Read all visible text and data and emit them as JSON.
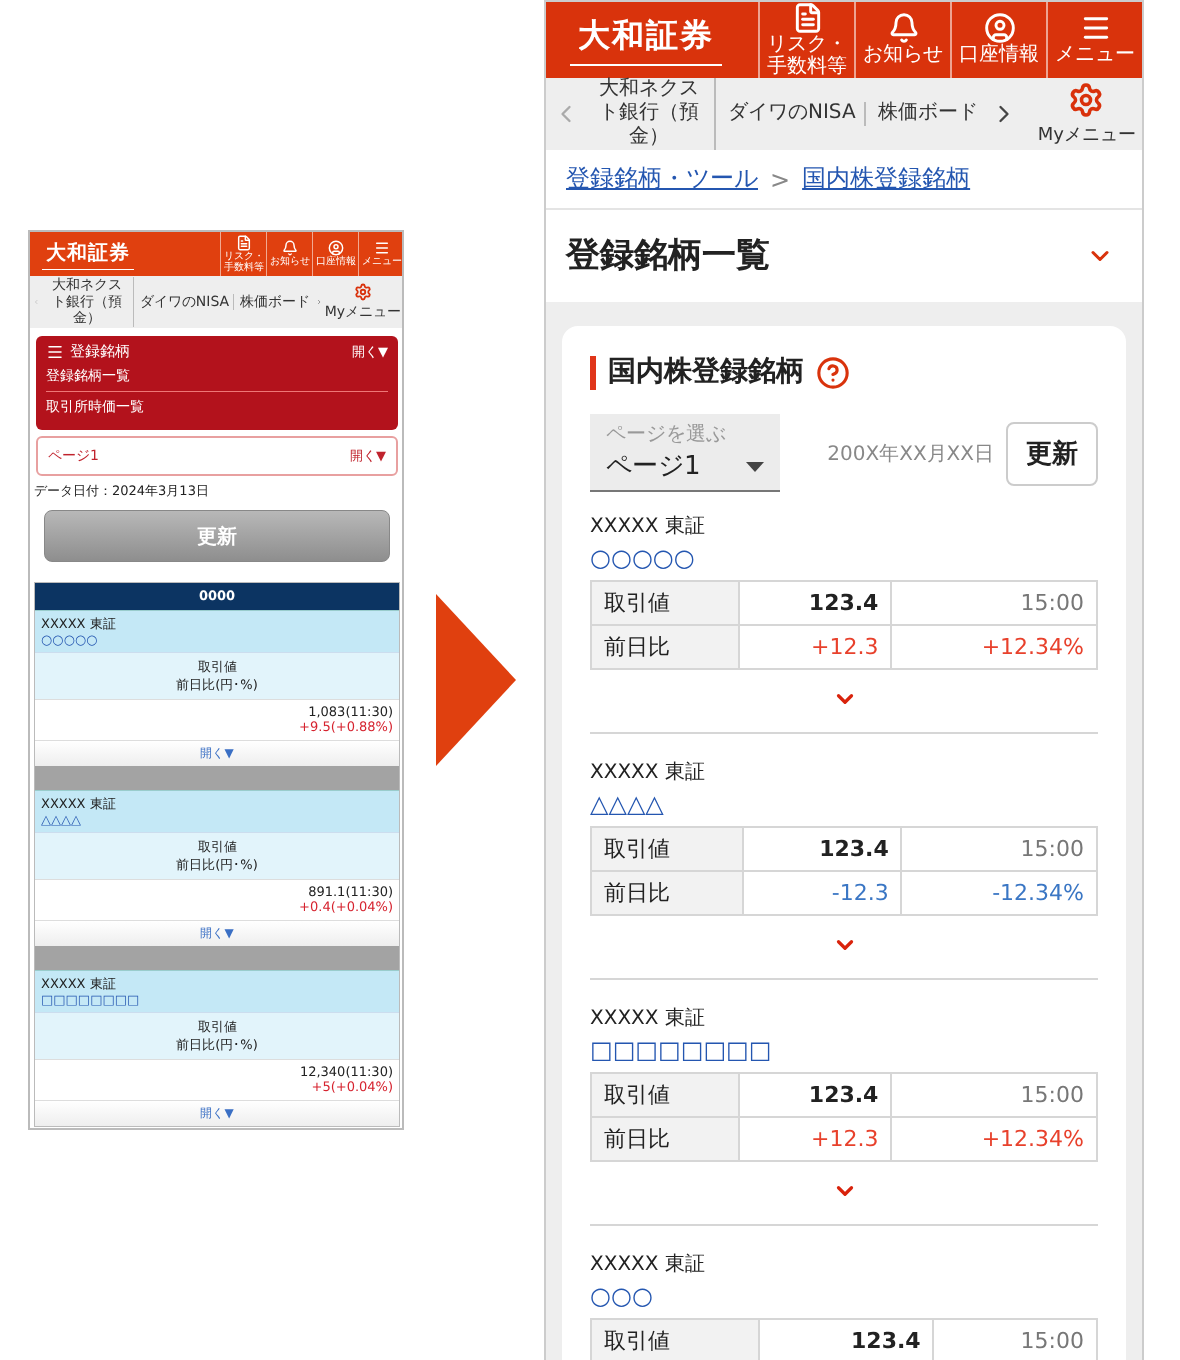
{
  "before": {
    "header": {
      "logo": "大和証券",
      "buttons": [
        {
          "kind": "document",
          "label": "リスク・手数料等"
        },
        {
          "kind": "bell",
          "label": "お知らせ"
        },
        {
          "kind": "user",
          "label": "口座情報"
        },
        {
          "kind": "menu",
          "label": "メニュー"
        }
      ]
    },
    "nav": {
      "items": [
        "大和ネクスト銀行（預金）",
        "ダイワのNISA",
        "株価ボード"
      ],
      "my_menu": "Myメニュー"
    },
    "menu": {
      "title": "登録銘柄",
      "toggle": "開く▼",
      "items": [
        "登録銘柄一覧",
        "取引所時価一覧"
      ]
    },
    "page_select": {
      "value": "ページ1",
      "toggle": "開く▼"
    },
    "data_date": "データ日付：2024年3月13日",
    "update_button": "更新",
    "table": {
      "header": "0000",
      "rows": [
        {
          "name": "XXXXX 東証",
          "symbol": "○○○○○",
          "label_1": "取引値",
          "label_2": "前日比(円･%)",
          "price": "1,083(11:30)",
          "change": "+9.5(+0.88%)",
          "color": "#d6232f",
          "toggle": "開く▼"
        },
        {
          "name": "XXXXX 東証",
          "symbol": "△△△△",
          "label_1": "取引値",
          "label_2": "前日比(円･%)",
          "price": "891.1(11:30)",
          "change": "+0.4(+0.04%)",
          "color": "#d6232f",
          "toggle": "開く▼"
        },
        {
          "name": "XXXXX 東証",
          "symbol": "□□□□□□□□",
          "label_1": "取引値",
          "label_2": "前日比(円･%)",
          "price": "12,340(11:30)",
          "change": "+5(+0.04%)",
          "color": "#d6232f",
          "toggle": "開く▼"
        }
      ]
    }
  },
  "after": {
    "header": {
      "logo": "大和証券",
      "buttons": [
        {
          "kind": "document",
          "label": "リスク・手数料等"
        },
        {
          "kind": "bell",
          "label": "お知らせ"
        },
        {
          "kind": "user",
          "label": "口座情報"
        },
        {
          "kind": "menu",
          "label": "メニュー"
        }
      ]
    },
    "nav": {
      "items": [
        "大和ネクスト銀行（預金）",
        "ダイワのNISA",
        "株価ボード"
      ],
      "my_menu": "Myメニュー"
    },
    "breadcrumb": [
      "登録銘柄・ツール",
      "国内株登録銘柄"
    ],
    "breadcrumb_separator": ">",
    "title": "登録銘柄一覧",
    "card": {
      "title": "国内株登録銘柄",
      "select": {
        "placeholder": "ページを選ぶ",
        "value": "ページ1"
      },
      "date": "200X年XX月XX日",
      "update_button": "更新",
      "items": [
        {
          "name": "XXXXX",
          "market": "東証",
          "symbol": "○○○○○",
          "price_label": "取引値",
          "price": "123.4",
          "time": "15:00",
          "change_label": "前日比",
          "change": "+12.3",
          "change_pct": "+12.34%",
          "color": "#e8412c"
        },
        {
          "name": "XXXXX",
          "market": "東証",
          "symbol": "△△△△",
          "price_label": "取引値",
          "price": "123.4",
          "time": "15:00",
          "change_label": "前日比",
          "change": "-12.3",
          "change_pct": "-12.34%",
          "color": "#3a76c4"
        },
        {
          "name": "XXXXX",
          "market": "東証",
          "symbol": "□□□□□□□□",
          "price_label": "取引値",
          "price": "123.4",
          "time": "15:00",
          "change_label": "前日比",
          "change": "+12.3",
          "change_pct": "+12.34%",
          "color": "#e8412c"
        },
        {
          "name": "XXXXX",
          "market": "東証",
          "symbol": "○○○",
          "price_label": "取引値",
          "price": "123.4",
          "time": "15:00"
        }
      ]
    }
  }
}
